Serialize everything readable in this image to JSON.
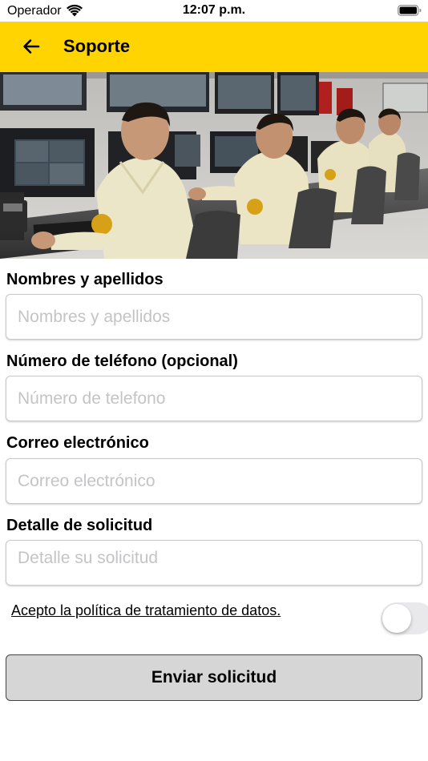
{
  "status_bar": {
    "carrier": "Operador",
    "time": "12:07 p.m."
  },
  "navbar": {
    "title": "Soporte",
    "color": "#ffd400"
  },
  "form": {
    "name": {
      "label": "Nombres y apellidos",
      "placeholder": "Nombres y apellidos",
      "value": ""
    },
    "phone": {
      "label": "Número de teléfono (opcional)",
      "placeholder": "Número de telefono",
      "value": ""
    },
    "email": {
      "label": "Correo electrónico",
      "placeholder": "Correo electrónico",
      "value": ""
    },
    "detail": {
      "label": "Detalle de solicitud",
      "placeholder": "Detalle su solicitud",
      "value": ""
    },
    "policy": {
      "label": "Acepto la política de tratamiento de datos.",
      "accepted": false
    },
    "submit_label": "Enviar solicitud"
  }
}
